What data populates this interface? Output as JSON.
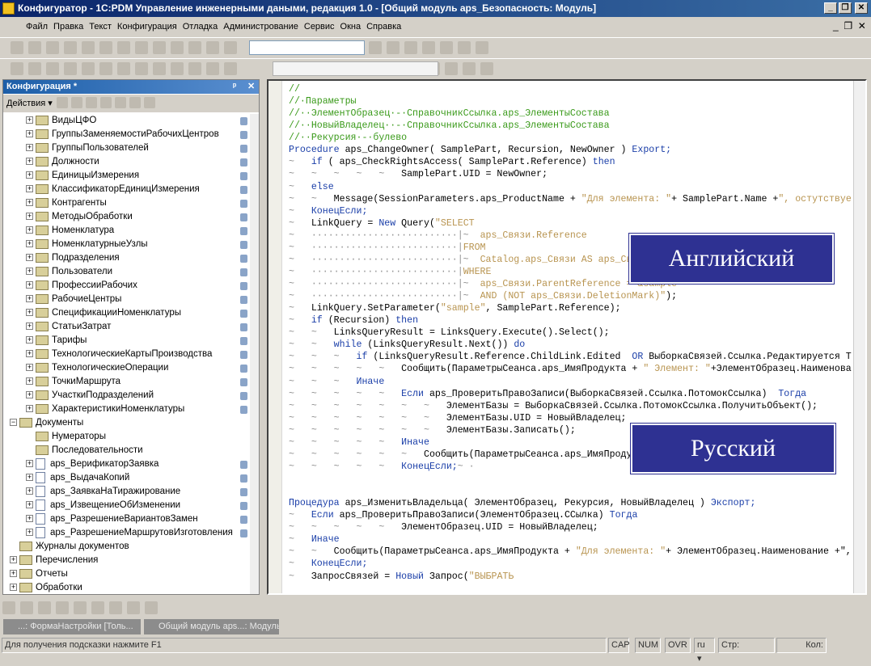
{
  "window": {
    "title": "Конфигуратор - 1С:PDM Управление инженерными даными, редакция 1.0 - [Общий модуль aps_Безопасность: Модуль]",
    "minimize": "_",
    "restore": "❐",
    "close": "✕"
  },
  "menu": [
    "Файл",
    "Правка",
    "Текст",
    "Конфигурация",
    "Отладка",
    "Администрование",
    "Сервис",
    "Окна",
    "Справка"
  ],
  "left_panel": {
    "title": "Конфигурация *",
    "actions_label": "Действия ▾",
    "pin": "ᵖ",
    "close": "✕"
  },
  "tree": [
    {
      "label": "ВидыЦФО",
      "level": 2,
      "exp": "+",
      "icon": "folder",
      "lock": true
    },
    {
      "label": "ГруппыЗаменяемостиРабочихЦентров",
      "level": 2,
      "exp": "+",
      "icon": "folder",
      "lock": true
    },
    {
      "label": "ГруппыПользователей",
      "level": 2,
      "exp": "+",
      "icon": "folder",
      "lock": true
    },
    {
      "label": "Должности",
      "level": 2,
      "exp": "+",
      "icon": "folder",
      "lock": true
    },
    {
      "label": "ЕдиницыИзмерения",
      "level": 2,
      "exp": "+",
      "icon": "folder",
      "lock": true
    },
    {
      "label": "КлассификаторЕдиницИзмерения",
      "level": 2,
      "exp": "+",
      "icon": "folder",
      "lock": true
    },
    {
      "label": "Контрагенты",
      "level": 2,
      "exp": "+",
      "icon": "folder",
      "lock": true
    },
    {
      "label": "МетодыОбработки",
      "level": 2,
      "exp": "+",
      "icon": "folder",
      "lock": true
    },
    {
      "label": "Номенклатура",
      "level": 2,
      "exp": "+",
      "icon": "folder",
      "lock": true
    },
    {
      "label": "НоменклатурныеУзлы",
      "level": 2,
      "exp": "+",
      "icon": "folder",
      "lock": true
    },
    {
      "label": "Подразделения",
      "level": 2,
      "exp": "+",
      "icon": "folder",
      "lock": true
    },
    {
      "label": "Пользователи",
      "level": 2,
      "exp": "+",
      "icon": "folder",
      "lock": true
    },
    {
      "label": "ПрофессииРабочих",
      "level": 2,
      "exp": "+",
      "icon": "folder",
      "lock": true
    },
    {
      "label": "РабочиеЦентры",
      "level": 2,
      "exp": "+",
      "icon": "folder",
      "lock": true
    },
    {
      "label": "СпецификацииНоменклатуры",
      "level": 2,
      "exp": "+",
      "icon": "folder",
      "lock": true
    },
    {
      "label": "СтатьиЗатрат",
      "level": 2,
      "exp": "+",
      "icon": "folder",
      "lock": true
    },
    {
      "label": "Тарифы",
      "level": 2,
      "exp": "+",
      "icon": "folder",
      "lock": true
    },
    {
      "label": "ТехнологическиеКартыПроизводства",
      "level": 2,
      "exp": "+",
      "icon": "folder",
      "lock": true
    },
    {
      "label": "ТехнологическиеОперации",
      "level": 2,
      "exp": "+",
      "icon": "folder",
      "lock": true
    },
    {
      "label": "ТочкиМаршрута",
      "level": 2,
      "exp": "+",
      "icon": "folder",
      "lock": true
    },
    {
      "label": "УчасткиПодразделений",
      "level": 2,
      "exp": "+",
      "icon": "folder",
      "lock": true
    },
    {
      "label": "ХарактеристикиНоменклатуры",
      "level": 2,
      "exp": "+",
      "icon": "folder",
      "lock": true
    },
    {
      "label": "Документы",
      "level": 1,
      "exp": "−",
      "icon": "folder",
      "lock": false
    },
    {
      "label": "Нумераторы",
      "level": 2,
      "exp": "",
      "icon": "folder",
      "lock": false
    },
    {
      "label": "Последовательности",
      "level": 2,
      "exp": "",
      "icon": "folder",
      "lock": false
    },
    {
      "label": "aps_ВерификаторЗаявка",
      "level": 2,
      "exp": "+",
      "icon": "doc",
      "lock": true
    },
    {
      "label": "aps_ВыдачаКопий",
      "level": 2,
      "exp": "+",
      "icon": "doc",
      "lock": true
    },
    {
      "label": "aps_ЗаявкаНаТиражирование",
      "level": 2,
      "exp": "+",
      "icon": "doc",
      "lock": true
    },
    {
      "label": "aps_ИзвещениеОбИзменении",
      "level": 2,
      "exp": "+",
      "icon": "doc",
      "lock": true
    },
    {
      "label": "aps_РазрешениеВариантовЗамен",
      "level": 2,
      "exp": "+",
      "icon": "doc",
      "lock": true
    },
    {
      "label": "aps_РазрешениеМаршрутовИзготовления",
      "level": 2,
      "exp": "+",
      "icon": "doc",
      "lock": true
    },
    {
      "label": "Журналы документов",
      "level": 1,
      "exp": "",
      "icon": "folder",
      "lock": false
    },
    {
      "label": "Перечисления",
      "level": 1,
      "exp": "+",
      "icon": "folder",
      "lock": false
    },
    {
      "label": "Отчеты",
      "level": 1,
      "exp": "+",
      "icon": "folder",
      "lock": false
    },
    {
      "label": "Обработки",
      "level": 1,
      "exp": "+",
      "icon": "folder",
      "lock": false
    }
  ],
  "code": [
    [
      [
        "c",
        "//"
      ]
    ],
    [
      [
        "c",
        "//·Параметры"
      ]
    ],
    [
      [
        "c",
        "//··ЭлементОбразец·-·СправочникСсылка.aps_ЭлементыСостава"
      ]
    ],
    [
      [
        "c",
        "//··НовыйВладелец··-·СправочникСсылка.aps_ЭлементыСостава"
      ]
    ],
    [
      [
        "c",
        "//··Рекурсия·-·булево"
      ]
    ],
    [
      [
        "k",
        "Procedure"
      ],
      [
        "p",
        " aps_ChangeOwner( SamplePart, Recursion, NewOwner ) "
      ],
      [
        "k",
        "Export;"
      ]
    ],
    [
      [
        "t",
        "~   "
      ],
      [
        "k",
        "if"
      ],
      [
        "p",
        " ( aps_CheckRightsAccess( SamplePart.Reference) "
      ],
      [
        "k",
        "then"
      ]
    ],
    [
      [
        "t",
        "~   ~   ~   ~   ~   "
      ],
      [
        "p",
        "SamplePart.UID = NewOwner;"
      ]
    ],
    [
      [
        "t",
        "~   "
      ],
      [
        "k",
        "else"
      ]
    ],
    [
      [
        "t",
        "~   ~   "
      ],
      [
        "p",
        "Message(SessionParameters.aps_ProductName + "
      ],
      [
        "s",
        "\"Для элемента: \""
      ],
      [
        "p",
        "+ SamplePart.Name +"
      ],
      [
        "s",
        "\", остутствуе"
      ]
    ],
    [
      [
        "t",
        "~   "
      ],
      [
        "k",
        "КонецЕсли;"
      ]
    ],
    [
      [
        "t",
        "~   "
      ],
      [
        "p",
        "LinkQuery = "
      ],
      [
        "k",
        "New"
      ],
      [
        "p",
        " Query("
      ],
      [
        "s",
        "\"SELECT"
      ]
    ],
    [
      [
        "t",
        "~   ··························|~  "
      ],
      [
        "s",
        "aps_Связи.Reference"
      ]
    ],
    [
      [
        "t",
        "~   ··························|"
      ],
      [
        "s",
        "FROM"
      ]
    ],
    [
      [
        "t",
        "~   ··························|~  "
      ],
      [
        "s",
        "Catalog.aps_Связи AS aps_Связи"
      ]
    ],
    [
      [
        "t",
        "~   ··························|"
      ],
      [
        "s",
        "WHERE"
      ]
    ],
    [
      [
        "t",
        "~   ··························|~  "
      ],
      [
        "s",
        "aps_Связи.ParentReference = &sample"
      ]
    ],
    [
      [
        "t",
        "~   ··························|~  "
      ],
      [
        "s",
        "AND (NOT aps_Связи.DeletionMark)\""
      ],
      [
        "p",
        ");"
      ]
    ],
    [
      [
        "t",
        "~   "
      ],
      [
        "p",
        "LinkQuery.SetParameter("
      ],
      [
        "s",
        "\"sample\""
      ],
      [
        "p",
        ", SamplePart.Reference);"
      ]
    ],
    [
      [
        "t",
        "~   "
      ],
      [
        "k",
        "if"
      ],
      [
        "p",
        " (Recursion) "
      ],
      [
        "k",
        "then"
      ]
    ],
    [
      [
        "t",
        "~   ~   "
      ],
      [
        "p",
        "LinksQueryResult = LinksQuery.Execute().Select();"
      ]
    ],
    [
      [
        "t",
        "~   ~   "
      ],
      [
        "k",
        "while"
      ],
      [
        "p",
        " (LinksQueryResult.Next()) "
      ],
      [
        "k",
        "do"
      ]
    ],
    [
      [
        "t",
        "~   ~   ~   "
      ],
      [
        "k",
        "if"
      ],
      [
        "p",
        " (LinksQueryResult.Reference.ChildLink.Edited  "
      ],
      [
        "k",
        "OR"
      ],
      [
        "p",
        " ВыборкаСвязей.Ссылка.Редактируется Т"
      ]
    ],
    [
      [
        "t",
        "~   ~   ~   ~   ~   "
      ],
      [
        "p",
        "Сообщить(ПараметрыСеанса.aps_ИмяПродукта + "
      ],
      [
        "s",
        "\" Элемент: \""
      ],
      [
        "p",
        "+ЭлементОбразец.Наименова"
      ]
    ],
    [
      [
        "t",
        "~   ~   ~   "
      ],
      [
        "k",
        "Иначе"
      ]
    ],
    [
      [
        "t",
        "~   ~   ~   ~   ~   "
      ],
      [
        "k",
        "Если"
      ],
      [
        "p",
        " aps_ПроверитьПравоЗаписи(ВыборкаСвязей.Ссылка.ПотомокСсылка)  "
      ],
      [
        "k",
        "Тогда"
      ]
    ],
    [
      [
        "t",
        "~   ~   ~   ~   ~   ~   ~   "
      ],
      [
        "p",
        "ЭлементБазы = ВыборкаСвязей.Ссылка.ПотомокСсылка.ПолучитьОбъект();"
      ]
    ],
    [
      [
        "t",
        "~   ~   ~   ~   ~   ~   ~   "
      ],
      [
        "p",
        "ЭлементБазы.UID = НовыйВладелец;"
      ]
    ],
    [
      [
        "t",
        "~   ~   ~   ~   ~   ~   ~   "
      ],
      [
        "p",
        "ЭлементБазы.Записать();"
      ]
    ],
    [
      [
        "t",
        "~   ~   ~   ~   ~   "
      ],
      [
        "k",
        "Иначе"
      ]
    ],
    [
      [
        "t",
        "~   ~   ~   ~   ~   ~   "
      ],
      [
        "p",
        "Сообщить(ПараметрыСеанса.aps_ИмяПродукта"
      ]
    ],
    [
      [
        "t",
        "~   ~   ~   ~   ~   "
      ],
      [
        "k",
        "КонецЕсли;"
      ],
      [
        "t",
        "~ ·"
      ]
    ],
    [],
    [],
    [
      [
        "k",
        "Процедура"
      ],
      [
        "p",
        " aps_ИзменитьВладельца( ЭлементОбразец, Рекурсия, НовыйВладелец ) "
      ],
      [
        "k",
        "Экспорт;"
      ]
    ],
    [
      [
        "t",
        "~   "
      ],
      [
        "k",
        "Если"
      ],
      [
        "p",
        " aps_ПроверитьПравоЗаписи(ЭлементОбразец.ССылка) "
      ],
      [
        "k",
        "Тогда"
      ]
    ],
    [
      [
        "t",
        "~   ~   ~   ~   ~   "
      ],
      [
        "p",
        "ЭлементОбразец.UID = НовыйВладелец;"
      ]
    ],
    [
      [
        "t",
        "~   "
      ],
      [
        "k",
        "Иначе"
      ]
    ],
    [
      [
        "t",
        "~   ~   "
      ],
      [
        "p",
        "Сообщить(ПараметрыСеанса.aps_ИмяПродукта + "
      ],
      [
        "s",
        "\"Для элемента: \""
      ],
      [
        "p",
        "+ ЭлементОбразец.Наименование +\","
      ]
    ],
    [
      [
        "t",
        "~   "
      ],
      [
        "k",
        "КонецЕсли;"
      ]
    ],
    [
      [
        "t",
        "~   "
      ],
      [
        "p",
        "ЗапросСвязей = "
      ],
      [
        "k",
        "Новый"
      ],
      [
        "p",
        " Запрос("
      ],
      [
        "s",
        "\"ВЫБРАТЬ"
      ]
    ]
  ],
  "overlays": {
    "english": "Английский",
    "russian": "Русский"
  },
  "tasks": [
    "...: ФормаНастройки [Толь...",
    "Общий модуль aps...: Модуль"
  ],
  "status": {
    "hint": "Для получения подсказки нажмите F1",
    "cap": "CAP",
    "num": "NUM",
    "ovr": "OVR",
    "lang": "ru ▾",
    "line": "Стр:",
    "col": "Кол:"
  },
  "colors": {
    "overlay": "#2e3192",
    "comment": "#3a9a1a",
    "keyword": "#1a3ea8",
    "string": "#b89450"
  }
}
